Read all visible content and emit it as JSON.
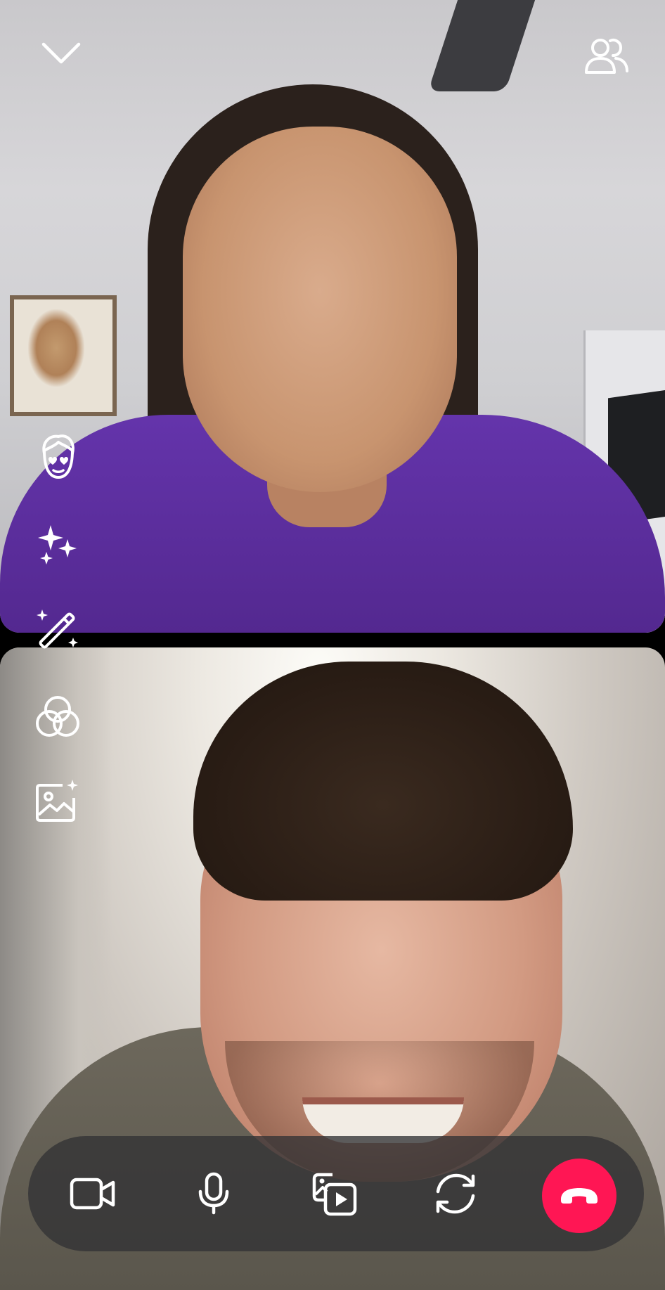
{
  "colors": {
    "background": "#000000",
    "icon": "#ffffff",
    "end_call": "#ff1654",
    "bar_background": "rgba(50,50,52,0.78)"
  },
  "top_bar": {
    "collapse_icon": "chevron-down-icon",
    "participants_icon": "participants-icon"
  },
  "video_tiles": [
    {
      "position": "top",
      "participant": "remote"
    },
    {
      "position": "bottom",
      "participant": "self"
    }
  ],
  "effect_tools": [
    {
      "icon": "face-filter-icon"
    },
    {
      "icon": "sparkles-icon"
    },
    {
      "icon": "magic-wand-icon"
    },
    {
      "icon": "color-filter-icon"
    },
    {
      "icon": "background-image-icon"
    }
  ],
  "call_controls": [
    {
      "icon": "video-camera-icon"
    },
    {
      "icon": "microphone-icon"
    },
    {
      "icon": "share-media-icon"
    },
    {
      "icon": "switch-camera-icon"
    },
    {
      "icon": "end-call-icon"
    }
  ]
}
